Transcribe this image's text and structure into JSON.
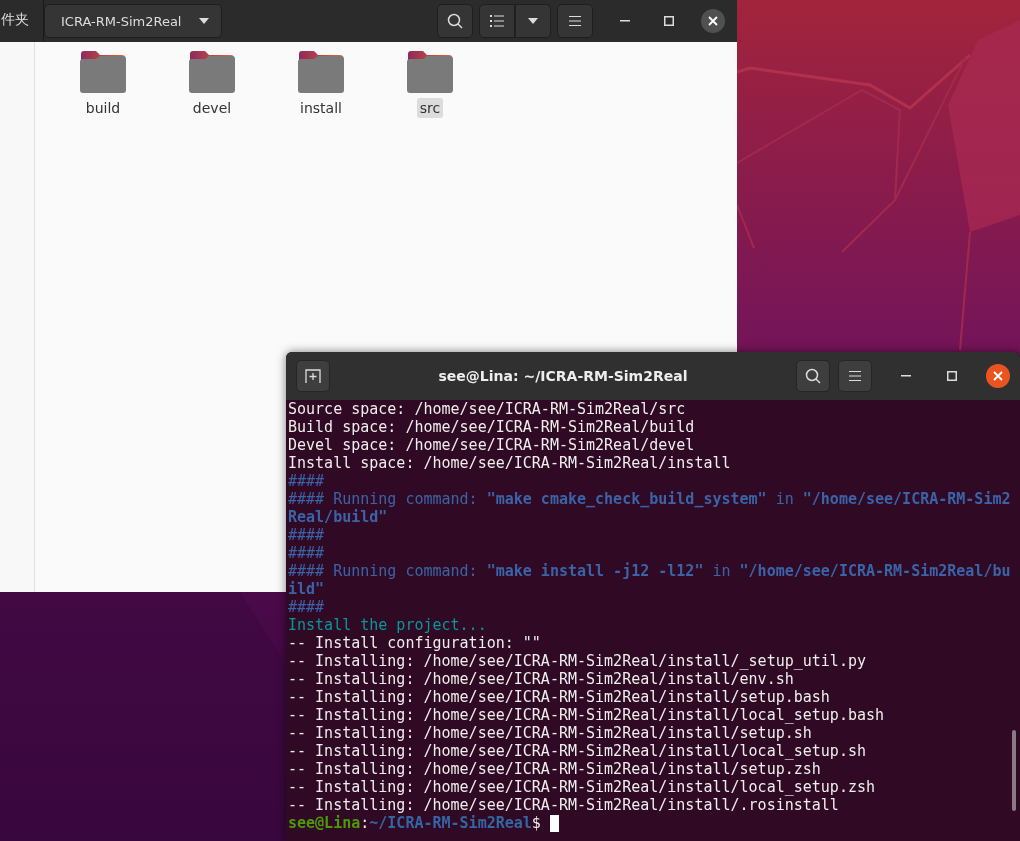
{
  "file_manager": {
    "breadcrumb_previous": "件夹",
    "current_folder": "ICRA-RM-Sim2Real",
    "items": [
      {
        "name": "build",
        "selected": false
      },
      {
        "name": "devel",
        "selected": false
      },
      {
        "name": "install",
        "selected": false
      },
      {
        "name": "src",
        "selected": true
      }
    ]
  },
  "terminal": {
    "title": "see@Lina: ~/ICRA-RM-Sim2Real",
    "lines": [
      {
        "kind": "plain",
        "text": "Source space: /home/see/ICRA-RM-Sim2Real/src"
      },
      {
        "kind": "plain",
        "text": "Build space: /home/see/ICRA-RM-Sim2Real/build"
      },
      {
        "kind": "plain",
        "text": "Devel space: /home/see/ICRA-RM-Sim2Real/devel"
      },
      {
        "kind": "plain",
        "text": "Install space: /home/see/ICRA-RM-Sim2Real/install"
      },
      {
        "kind": "info",
        "text": "####"
      },
      {
        "kind": "info",
        "text": "#### Running command: **\"make cmake_check_build_system\"** in **\"/home/see/ICRA-RM-Sim2**"
      },
      {
        "kind": "info-bold",
        "text": "Real/build\""
      },
      {
        "kind": "info",
        "text": "####"
      },
      {
        "kind": "info",
        "text": "####"
      },
      {
        "kind": "info",
        "text": "#### Running command: **\"make install -j12 -l12\"** in **\"/home/see/ICRA-RM-Sim2Real/bu**"
      },
      {
        "kind": "info-bold",
        "text": "ild\""
      },
      {
        "kind": "info",
        "text": "####"
      },
      {
        "kind": "status",
        "text": "Install the project..."
      },
      {
        "kind": "plain",
        "text": "-- Install configuration: \"\""
      },
      {
        "kind": "plain",
        "text": "-- Installing: /home/see/ICRA-RM-Sim2Real/install/_setup_util.py"
      },
      {
        "kind": "plain",
        "text": "-- Installing: /home/see/ICRA-RM-Sim2Real/install/env.sh"
      },
      {
        "kind": "plain",
        "text": "-- Installing: /home/see/ICRA-RM-Sim2Real/install/setup.bash"
      },
      {
        "kind": "plain",
        "text": "-- Installing: /home/see/ICRA-RM-Sim2Real/install/local_setup.bash"
      },
      {
        "kind": "plain",
        "text": "-- Installing: /home/see/ICRA-RM-Sim2Real/install/setup.sh"
      },
      {
        "kind": "plain",
        "text": "-- Installing: /home/see/ICRA-RM-Sim2Real/install/local_setup.sh"
      },
      {
        "kind": "plain",
        "text": "-- Installing: /home/see/ICRA-RM-Sim2Real/install/setup.zsh"
      },
      {
        "kind": "plain",
        "text": "-- Installing: /home/see/ICRA-RM-Sim2Real/install/local_setup.zsh"
      },
      {
        "kind": "plain",
        "text": "-- Installing: /home/see/ICRA-RM-Sim2Real/install/.rosinstall"
      }
    ],
    "prompt": {
      "user_host": "see@Lina",
      "separator": ":",
      "path": "~/ICRA-RM-Sim2Real",
      "symbol": "$"
    }
  }
}
